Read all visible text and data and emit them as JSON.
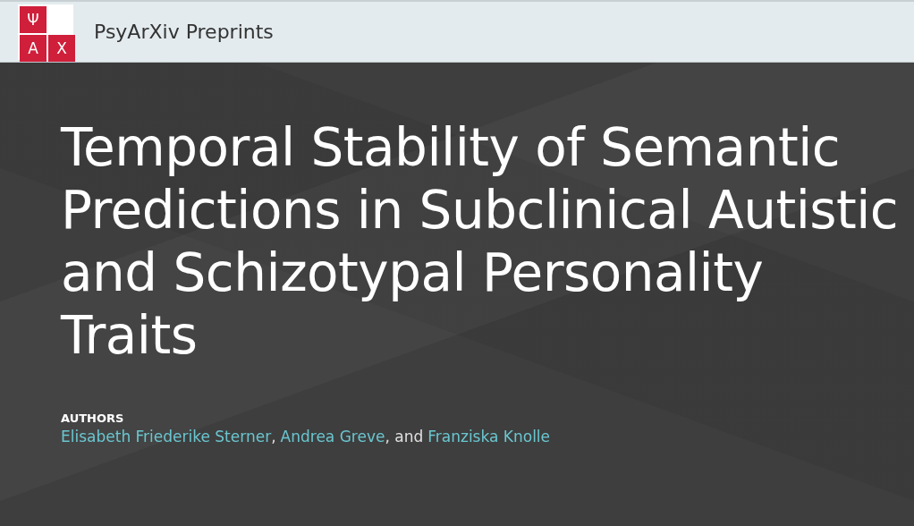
{
  "header": {
    "logo": {
      "cells": [
        {
          "kind": "letter",
          "text": "Ψ"
        },
        {
          "kind": "blank"
        },
        {
          "kind": "letter",
          "text": "A"
        },
        {
          "kind": "letter",
          "text": "X"
        }
      ]
    },
    "title": "PsyArXiv Preprints"
  },
  "preprint": {
    "title": "Temporal Stability of Semantic Predictions in Subclinical Autistic and Schizotypal Personality Traits",
    "authors_label": "AUTHORS",
    "authors": [
      {
        "kind": "link",
        "text": "Elisabeth Friederike Sterner"
      },
      {
        "kind": "plain",
        "text": ","
      },
      {
        "kind": "link",
        "text": "Andrea Greve"
      },
      {
        "kind": "plain",
        "text": ", and"
      },
      {
        "kind": "link",
        "text": "Franziska Knolle"
      }
    ]
  }
}
